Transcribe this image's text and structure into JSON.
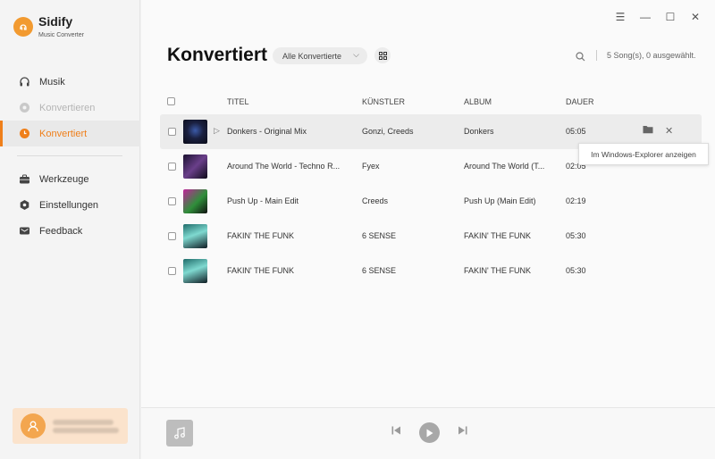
{
  "brand": {
    "name": "Sidify",
    "subtitle": "Music Converter"
  },
  "nav": {
    "items": [
      {
        "label": "Musik",
        "state": "normal",
        "icon": "headphones-icon"
      },
      {
        "label": "Konvertieren",
        "state": "disabled",
        "icon": "convert-icon"
      },
      {
        "label": "Konvertiert",
        "state": "active",
        "icon": "clock-icon"
      }
    ],
    "tools": [
      {
        "label": "Werkzeuge",
        "icon": "toolbox-icon"
      },
      {
        "label": "Einstellungen",
        "icon": "settings-icon"
      },
      {
        "label": "Feedback",
        "icon": "mail-icon"
      }
    ]
  },
  "header": {
    "title": "Konvertiert",
    "filter": "Alle Konvertierte",
    "song_count": "5 Song(s), 0 ausgewählt."
  },
  "table": {
    "columns": {
      "title": "TITEL",
      "artist": "KÜNSTLER",
      "album": "ALBUM",
      "duration": "DAUER"
    },
    "rows": [
      {
        "title": "Donkers - Original Mix",
        "artist": "Gonzi, Creeds",
        "album": "Donkers",
        "duration": "05:05"
      },
      {
        "title": "Around The World - Techno R...",
        "artist": "Fyex",
        "album": "Around The World (T...",
        "duration": "02:05"
      },
      {
        "title": "Push Up - Main Edit",
        "artist": "Creeds",
        "album": "Push Up (Main Edit)",
        "duration": "02:19"
      },
      {
        "title": "FAKIN' THE FUNK",
        "artist": "6 SENSE",
        "album": "FAKIN' THE FUNK",
        "duration": "05:30"
      },
      {
        "title": "FAKIN' THE FUNK",
        "artist": "6 SENSE",
        "album": "FAKIN' THE FUNK",
        "duration": "05:30"
      }
    ]
  },
  "tooltip": "Im Windows-Explorer anzeigen",
  "colors": {
    "accent": "#ef7f1a",
    "user_card": "#fbe3cc"
  }
}
